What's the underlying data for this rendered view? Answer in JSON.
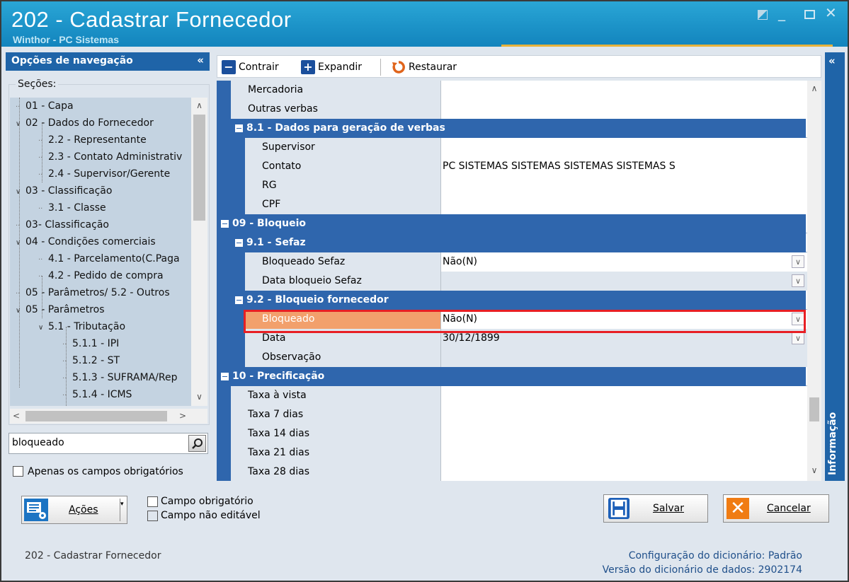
{
  "window": {
    "title": "202 - Cadastrar  Fornecedor",
    "subtitle": "Winthor - PC Sistemas"
  },
  "nav": {
    "title": "Opções de navegação",
    "collapse": "«",
    "sections_label": "Seções:",
    "tree": [
      {
        "label": "01 - Capa",
        "level": 0,
        "toggle": ""
      },
      {
        "label": "02 - Dados do Fornecedor",
        "level": 0,
        "toggle": "∨"
      },
      {
        "label": "2.2 - Representante",
        "level": 1,
        "toggle": ""
      },
      {
        "label": "2.3 - Contato Administrativ",
        "level": 1,
        "toggle": ""
      },
      {
        "label": "2.4 - Supervisor/Gerente",
        "level": 1,
        "toggle": ""
      },
      {
        "label": "03 - Classificação",
        "level": 0,
        "toggle": "∨"
      },
      {
        "label": "3.1 - Classe",
        "level": 1,
        "toggle": ""
      },
      {
        "label": "03- Classificação",
        "level": 0,
        "toggle": ""
      },
      {
        "label": "04 - Condições comerciais",
        "level": 0,
        "toggle": "∨"
      },
      {
        "label": "4.1 - Parcelamento(C.Paga",
        "level": 1,
        "toggle": ""
      },
      {
        "label": "4.2 - Pedido de compra",
        "level": 1,
        "toggle": ""
      },
      {
        "label": "05 - Parâmetros/ 5.2 - Outros",
        "level": 0,
        "toggle": ""
      },
      {
        "label": "05 - Parâmetros",
        "level": 0,
        "toggle": "∨"
      },
      {
        "label": "5.1 - Tributação",
        "level": 1,
        "toggle": "∨"
      },
      {
        "label": "5.1.1 - IPI",
        "level": 2,
        "toggle": ""
      },
      {
        "label": "5.1.2 - ST",
        "level": 2,
        "toggle": ""
      },
      {
        "label": "5.1.3 - SUFRAMA/Rep",
        "level": 2,
        "toggle": ""
      },
      {
        "label": "5.1.4 - ICMS",
        "level": 2,
        "toggle": ""
      }
    ],
    "search_value": "bloqueado",
    "required_only_label": "Apenas os campos obrigatórios"
  },
  "toolbar": {
    "contrair": "Contrair",
    "expandir": "Expandir",
    "restaurar": "Restaurar"
  },
  "grid": {
    "rows": [
      {
        "kind": "field",
        "indent": 1,
        "label": "Mercadoria",
        "value": "",
        "dropdown": false,
        "readonly": false
      },
      {
        "kind": "field",
        "indent": 1,
        "label": "Outras verbas",
        "value": "",
        "dropdown": false,
        "readonly": false
      },
      {
        "kind": "header",
        "indent": 1,
        "label": "8.1 - Dados para geração de verbas"
      },
      {
        "kind": "field",
        "indent": 2,
        "label": "Supervisor",
        "value": "",
        "dropdown": false,
        "readonly": false
      },
      {
        "kind": "field",
        "indent": 2,
        "label": "Contato",
        "value": "PC SISTEMAS SISTEMAS SISTEMAS SISTEMAS S",
        "dropdown": false,
        "readonly": false
      },
      {
        "kind": "field",
        "indent": 2,
        "label": "RG",
        "value": "",
        "dropdown": false,
        "readonly": false
      },
      {
        "kind": "field",
        "indent": 2,
        "label": "CPF",
        "value": "",
        "dropdown": false,
        "readonly": false
      },
      {
        "kind": "header",
        "indent": 0,
        "label": "09 - Bloqueio"
      },
      {
        "kind": "header",
        "indent": 1,
        "label": "9.1 - Sefaz"
      },
      {
        "kind": "field",
        "indent": 2,
        "label": "Bloqueado Sefaz",
        "value": "Não(N)",
        "dropdown": true,
        "readonly": false
      },
      {
        "kind": "field",
        "indent": 2,
        "label": "Data bloqueio Sefaz",
        "value": "",
        "dropdown": true,
        "readonly": true
      },
      {
        "kind": "header",
        "indent": 1,
        "label": "9.2 - Bloqueio fornecedor"
      },
      {
        "kind": "field",
        "indent": 2,
        "label": "Bloqueado",
        "value": "Não(N)",
        "dropdown": true,
        "readonly": false,
        "selected": true
      },
      {
        "kind": "field",
        "indent": 2,
        "label": "Data",
        "value": "30/12/1899",
        "dropdown": true,
        "readonly": true
      },
      {
        "kind": "field",
        "indent": 2,
        "label": "Observação",
        "value": "",
        "dropdown": false,
        "readonly": true
      },
      {
        "kind": "header",
        "indent": 0,
        "label": "10 - Precificação"
      },
      {
        "kind": "field",
        "indent": 1,
        "label": "Taxa à vista",
        "value": "",
        "dropdown": false,
        "readonly": false
      },
      {
        "kind": "field",
        "indent": 1,
        "label": "Taxa 7 dias",
        "value": "",
        "dropdown": false,
        "readonly": false
      },
      {
        "kind": "field",
        "indent": 1,
        "label": "Taxa 14 dias",
        "value": "",
        "dropdown": false,
        "readonly": false
      },
      {
        "kind": "field",
        "indent": 1,
        "label": "Taxa 21 dias",
        "value": "",
        "dropdown": false,
        "readonly": false
      },
      {
        "kind": "field",
        "indent": 1,
        "label": "Taxa 28 dias",
        "value": "",
        "dropdown": false,
        "readonly": false
      }
    ]
  },
  "info_tab": {
    "label": "Informação",
    "collapse": "«"
  },
  "bottom": {
    "acoes_label": "Ações",
    "legend_required": "Campo obrigatório",
    "legend_readonly": "Campo não editável",
    "salvar_label": "Salvar",
    "cancelar_label": "Cancelar"
  },
  "status": {
    "screen_title": "202 - Cadastrar  Fornecedor",
    "dict_config_label": "Configuração do dicionário:",
    "dict_config_value": "Padrão",
    "dict_version_label": "Versão do dicionário de dados:",
    "dict_version_value": "2902174"
  },
  "colors": {
    "title_bar": "#1c93c8",
    "nav_header": "#1f64a8",
    "section_band": "#2f66ad",
    "selected_label": "#f2a06c",
    "highlight_frame": "#e81f24",
    "cancel_icon": "#f07c13"
  }
}
